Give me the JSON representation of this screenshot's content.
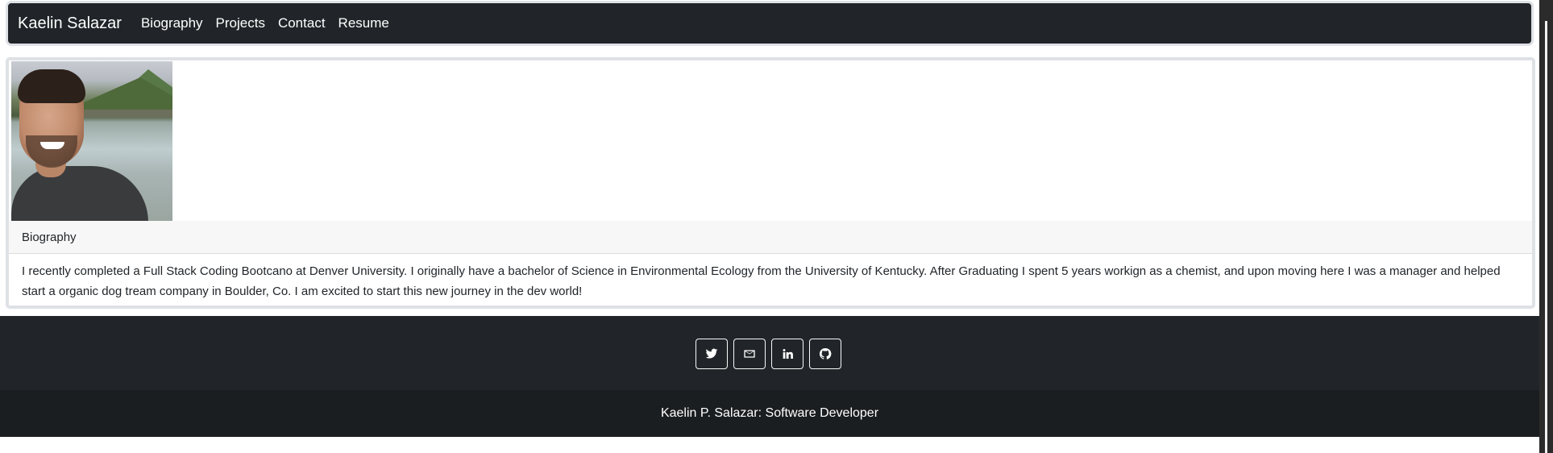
{
  "navbar": {
    "brand": "Kaelin Salazar",
    "links": [
      "Biography",
      "Projects",
      "Contact",
      "Resume"
    ]
  },
  "card": {
    "image_alt": "profile photo",
    "header": "Biography",
    "body": "I recently completed a Full Stack Coding Bootcano at Denver University. I originally have a bachelor of Science in Environmental Ecology from the University of Kentucky. After Graduating I spent 5 years workign as a chemist, and upon moving here I was a manager and helped start a organic dog tream company in Boulder, Co. I am excited to start this new journey in the dev world!"
  },
  "footer": {
    "social_icons": [
      "twitter-icon",
      "mail-icon",
      "linkedin-icon",
      "github-icon"
    ],
    "copyright": "Kaelin P. Salazar: Software Developer"
  },
  "colors": {
    "navbar_bg": "#212529",
    "footer_bg": "#212529",
    "copyright_bg": "#1b1e21",
    "border": "#dee2e6"
  }
}
